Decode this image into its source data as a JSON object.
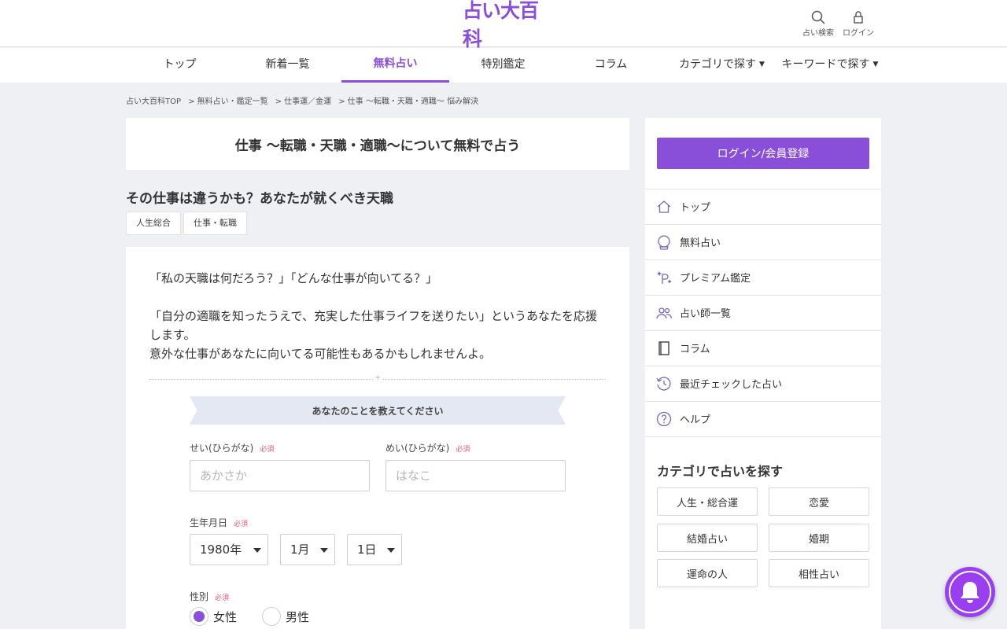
{
  "header": {
    "logo_text": "占い大百科",
    "search_label": "占い検索",
    "login_label": "ログイン"
  },
  "nav": {
    "items": [
      {
        "label": "トップ"
      },
      {
        "label": "新着一覧"
      },
      {
        "label": "無料占い",
        "active": true
      },
      {
        "label": "特別鑑定"
      },
      {
        "label": "コラム"
      },
      {
        "label": "カテゴリで探す",
        "dropdown": true
      },
      {
        "label": "キーワードで探す",
        "dropdown": true
      }
    ],
    "caret": "▼"
  },
  "breadcrumb": {
    "items": [
      "占い大百科TOP",
      "無料占い・鑑定一覧",
      "仕事運／金運",
      "仕事 〜転職・天職・適職〜 悩み解決"
    ],
    "separator": ">"
  },
  "main": {
    "page_title": "仕事 〜転職・天職・適職〜について無料で占う",
    "fortune_title": "その仕事は違うかも？あなたが就くべき天職",
    "tags": [
      "人生総合",
      "仕事・転職"
    ],
    "intro": [
      "「私の天職は何だろう？」「どんな仕事が向いてる？」",
      "「自分の適職を知ったうえで、充実した仕事ライフを送りたい」というあなたを応援します。",
      "意外な仕事があなたに向いてる可能性もあるかもしれませんよ。"
    ],
    "divider_mark": "+"
  },
  "form": {
    "section_title": "あなたのことを教えてください",
    "required_label": "必須",
    "last_name": {
      "label": "せい(ひらがな)",
      "placeholder": "あかさか",
      "value": ""
    },
    "first_name": {
      "label": "めい(ひらがな)",
      "placeholder": "はなこ",
      "value": ""
    },
    "birthday": {
      "label": "生年月日",
      "year": "1980年",
      "month": "1月",
      "day": "1日"
    },
    "gender": {
      "label": "性別",
      "options": [
        "女性",
        "男性"
      ],
      "selected": "女性"
    }
  },
  "sidebar": {
    "login_button": "ログイン/会員登録",
    "menu": [
      {
        "label": "トップ",
        "icon": "home-icon"
      },
      {
        "label": "無料占い",
        "icon": "crystal-ball-icon"
      },
      {
        "label": "プレミアム鑑定",
        "icon": "sparkle-p-icon"
      },
      {
        "label": "占い師一覧",
        "icon": "people-icon"
      },
      {
        "label": "コラム",
        "icon": "book-icon"
      },
      {
        "label": "最近チェックした占い",
        "icon": "history-icon"
      },
      {
        "label": "ヘルプ",
        "icon": "help-icon"
      }
    ],
    "category_title": "カテゴリで占いを探す",
    "categories": [
      "人生・総合運",
      "恋愛",
      "結婚占い",
      "婚期",
      "運命の人",
      "相性占い"
    ]
  },
  "colors": {
    "accent": "#8a4fd8",
    "background": "#eef0f4",
    "required": "#e05a7a"
  }
}
